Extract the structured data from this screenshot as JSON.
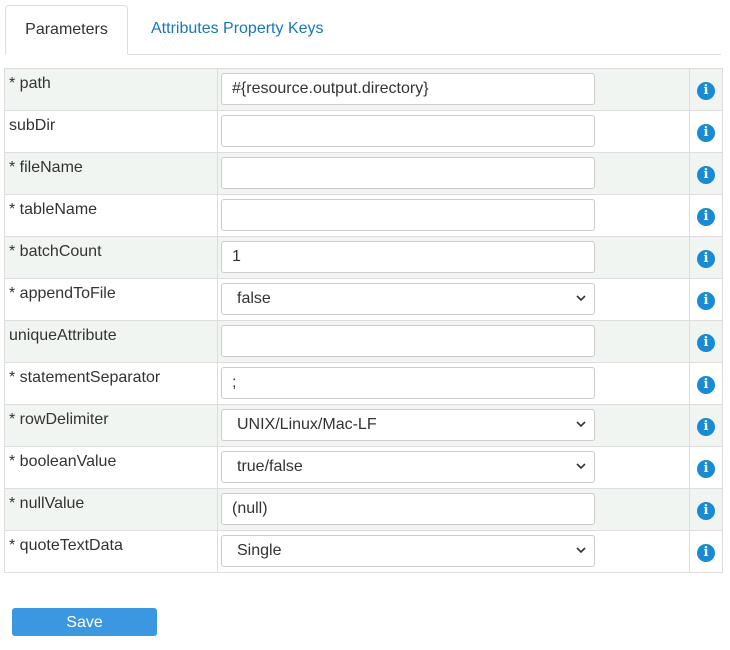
{
  "tabs": {
    "parameters": "Parameters",
    "attributes": "Attributes Property Keys"
  },
  "rows": [
    {
      "label": "* path",
      "value": "#{resource.output.directory}",
      "kind": "text"
    },
    {
      "label": "subDir",
      "value": "",
      "kind": "text"
    },
    {
      "label": "* fileName",
      "value": "",
      "kind": "text"
    },
    {
      "label": "* tableName",
      "value": "",
      "kind": "text"
    },
    {
      "label": "* batchCount",
      "value": "1",
      "kind": "text"
    },
    {
      "label": "* appendToFile",
      "value": "false",
      "kind": "select"
    },
    {
      "label": "uniqueAttribute",
      "value": "",
      "kind": "text"
    },
    {
      "label": "* statementSeparator",
      "value": ";",
      "kind": "text"
    },
    {
      "label": "* rowDelimiter",
      "value": "UNIX/Linux/Mac-LF",
      "kind": "select"
    },
    {
      "label": "* booleanValue",
      "value": "true/false",
      "kind": "select"
    },
    {
      "label": "* nullValue",
      "value": "(null)",
      "kind": "text"
    },
    {
      "label": "* quoteTextData",
      "value": "Single",
      "kind": "select"
    }
  ],
  "save_label": "Save",
  "info_icon_name": "info-icon",
  "colors": {
    "accent": "#1a75bb",
    "info_icon": "#1a8ad4",
    "save_button": "#3a97e0",
    "row_alt": "#f1f5f1"
  }
}
